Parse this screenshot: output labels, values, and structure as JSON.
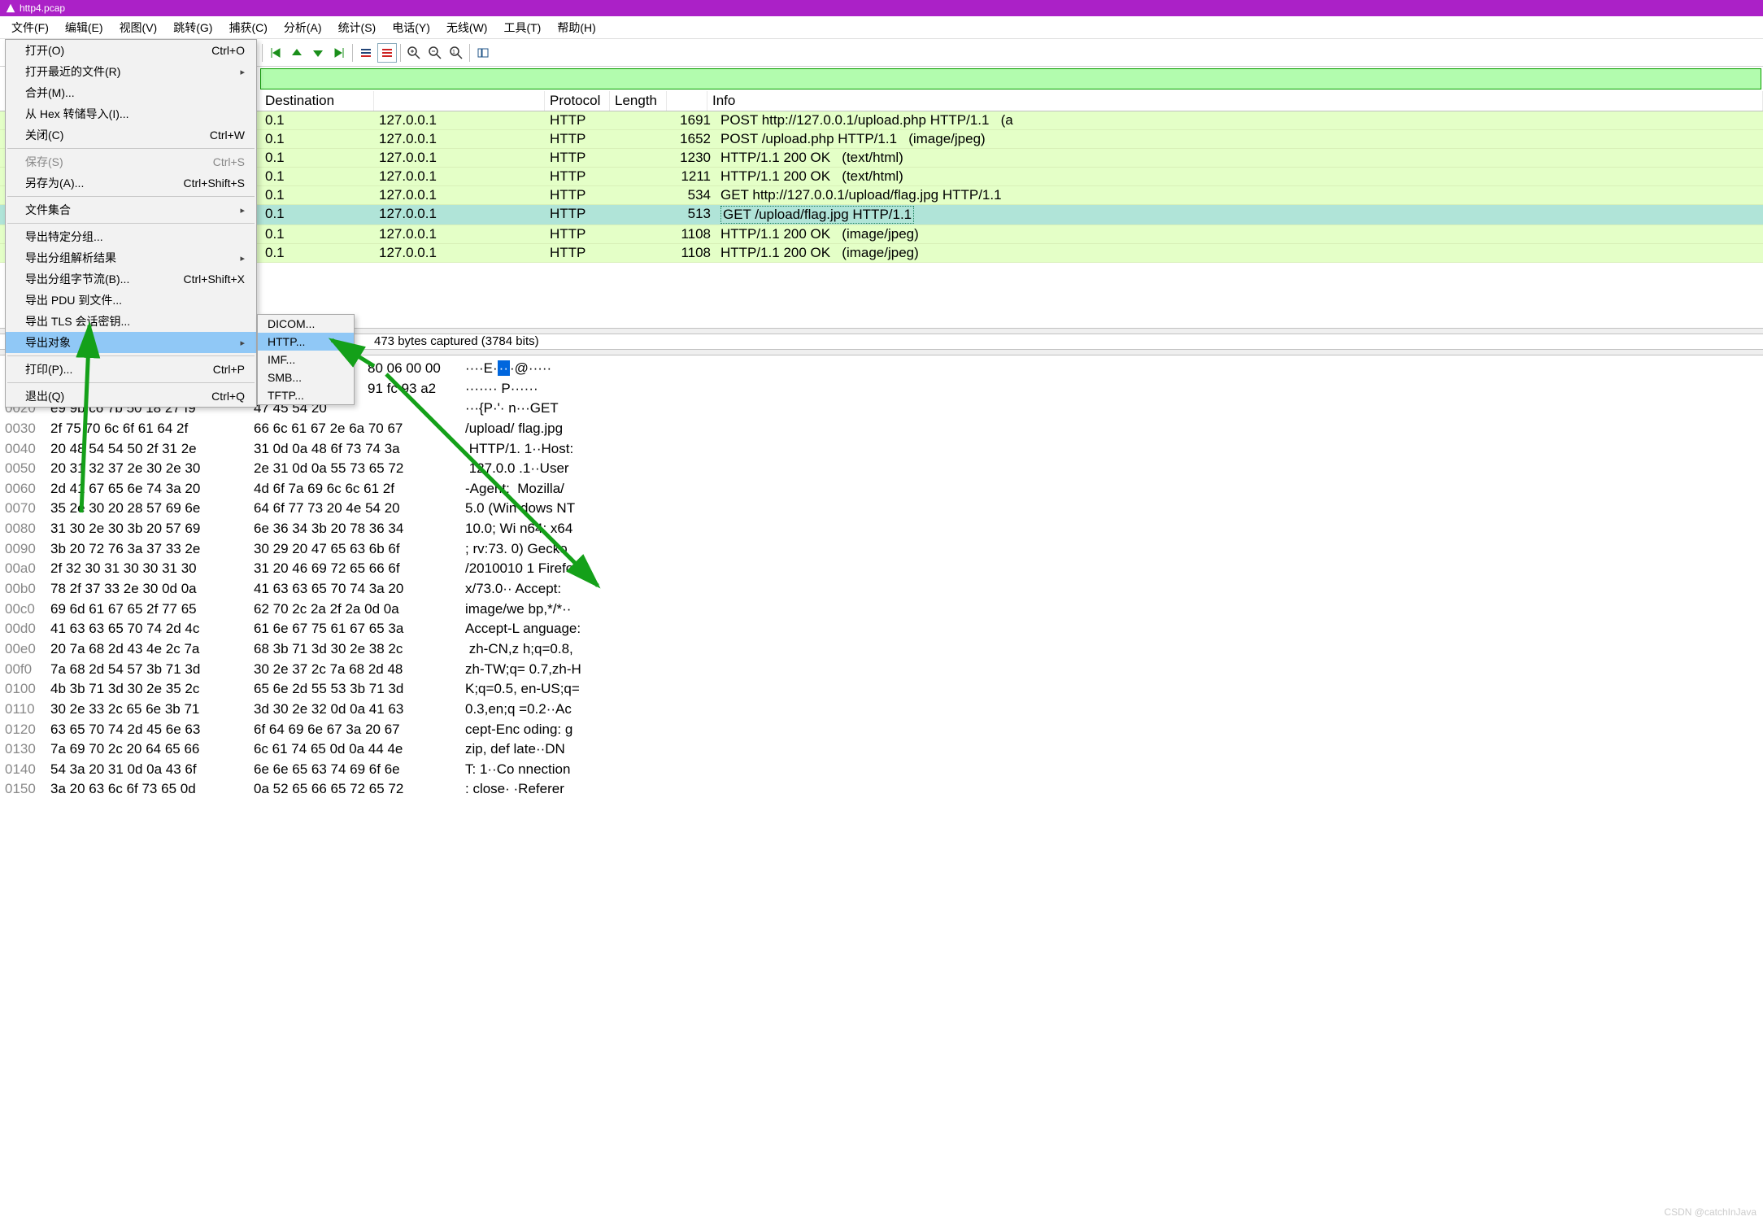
{
  "title": "http4.pcap",
  "menubar": [
    "文件(F)",
    "编辑(E)",
    "视图(V)",
    "跳转(G)",
    "捕获(C)",
    "分析(A)",
    "统计(S)",
    "电话(Y)",
    "无线(W)",
    "工具(T)",
    "帮助(H)"
  ],
  "file_menu": [
    {
      "label": "打开(O)",
      "accel": "Ctrl+O"
    },
    {
      "label": "打开最近的文件(R)",
      "accel": "",
      "arrow": true
    },
    {
      "label": "合并(M)...",
      "accel": ""
    },
    {
      "label": "从 Hex 转储导入(I)...",
      "accel": ""
    },
    {
      "label": "关闭(C)",
      "accel": "Ctrl+W"
    },
    {
      "sep": true
    },
    {
      "label": "保存(S)",
      "accel": "Ctrl+S",
      "dis": true
    },
    {
      "label": "另存为(A)...",
      "accel": "Ctrl+Shift+S"
    },
    {
      "sep": true
    },
    {
      "label": "文件集合",
      "accel": "",
      "arrow": true
    },
    {
      "sep": true
    },
    {
      "label": "导出特定分组...",
      "accel": ""
    },
    {
      "label": "导出分组解析结果",
      "accel": "",
      "arrow": true
    },
    {
      "label": "导出分组字节流(B)...",
      "accel": "Ctrl+Shift+X"
    },
    {
      "label": "导出 PDU 到文件...",
      "accel": ""
    },
    {
      "label": "导出 TLS 会话密钥...",
      "accel": ""
    },
    {
      "label": "导出对象",
      "accel": "",
      "arrow": true,
      "hl": true
    },
    {
      "sep": true
    },
    {
      "label": "打印(P)...",
      "accel": "Ctrl+P"
    },
    {
      "sep": true
    },
    {
      "label": "退出(Q)",
      "accel": "Ctrl+Q"
    }
  ],
  "submenu": [
    "DICOM...",
    "HTTP...",
    "IMF...",
    "SMB...",
    "TFTP..."
  ],
  "submenu_hl": 1,
  "packet_headers": {
    "dest": "Destination",
    "proto": "Protocol",
    "len": "Length",
    "info": "Info"
  },
  "packets": [
    {
      "sfx": "0.1",
      "dst": "127.0.0.1",
      "proto": "HTTP",
      "len": "1691",
      "info": "POST http://127.0.0.1/upload.php HTTP/1.1   (a"
    },
    {
      "sfx": "0.1",
      "dst": "127.0.0.1",
      "proto": "HTTP",
      "len": "1652",
      "info": "POST /upload.php HTTP/1.1   (image/jpeg)"
    },
    {
      "sfx": "0.1",
      "dst": "127.0.0.1",
      "proto": "HTTP",
      "len": "1230",
      "info": "HTTP/1.1 200 OK   (text/html)"
    },
    {
      "sfx": "0.1",
      "dst": "127.0.0.1",
      "proto": "HTTP",
      "len": "1211",
      "info": "HTTP/1.1 200 OK   (text/html)"
    },
    {
      "sfx": "0.1",
      "dst": "127.0.0.1",
      "proto": "HTTP",
      "len": "534",
      "info": "GET http://127.0.0.1/upload/flag.jpg HTTP/1.1"
    },
    {
      "sfx": "0.1",
      "dst": "127.0.0.1",
      "proto": "HTTP",
      "len": "513",
      "info": "GET /upload/flag.jpg HTTP/1.1",
      "sel": true,
      "infobox": true
    },
    {
      "sfx": "0.1",
      "dst": "127.0.0.1",
      "proto": "HTTP",
      "len": "1108",
      "info": "HTTP/1.1 200 OK   (image/jpeg)"
    },
    {
      "sfx": "0.1",
      "dst": "127.0.0.1",
      "proto": "HTTP",
      "len": "1108",
      "info": "HTTP/1.1 200 OK   (image/jpeg)"
    }
  ],
  "details_line": "473 bytes captured (3784 bits)",
  "hexrows": [
    {
      "a": "",
      "b1": "",
      "b2": "80 06 00 00",
      "asc": "····E·",
      "asc2": "·@·····",
      "mark": "··"
    },
    {
      "a": "",
      "b1": "",
      "b2": "91 fc 93 a2",
      "asc": "·······",
      "asc2": "P······"
    },
    {
      "a": "0020",
      "b1": "e9 9b c6 7b 50 18 27 f9",
      "b2": "47 45 54 20",
      "asc": "···{P·'·",
      "asc2": "n···GET "
    },
    {
      "a": "0030",
      "b1": "2f 75 70 6c 6f 61 64 2f",
      "b2": "66 6c 61 67 2e 6a 70 67",
      "asc": "/upload/",
      "asc2": "flag.jpg"
    },
    {
      "a": "0040",
      "b1": "20 48 54 54 50 2f 31 2e",
      "b2": "31 0d 0a 48 6f 73 74 3a",
      "asc": " HTTP/1.",
      "asc2": "1··Host:"
    },
    {
      "a": "0050",
      "b1": "20 31 32 37 2e 30 2e 30",
      "b2": "2e 31 0d 0a 55 73 65 72",
      "asc": " 127.0.0",
      "asc2": ".1··User"
    },
    {
      "a": "0060",
      "b1": "2d 41 67 65 6e 74 3a 20",
      "b2": "4d 6f 7a 69 6c 6c 61 2f",
      "asc": "-Agent: ",
      "asc2": "Mozilla/"
    },
    {
      "a": "0070",
      "b1": "35 2e 30 20 28 57 69 6e",
      "b2": "64 6f 77 73 20 4e 54 20",
      "asc": "5.0 (Win",
      "asc2": "dows NT "
    },
    {
      "a": "0080",
      "b1": "31 30 2e 30 3b 20 57 69",
      "b2": "6e 36 34 3b 20 78 36 34",
      "asc": "10.0; Wi",
      "asc2": "n64; x64"
    },
    {
      "a": "0090",
      "b1": "3b 20 72 76 3a 37 33 2e",
      "b2": "30 29 20 47 65 63 6b 6f",
      "asc": "; rv:73.",
      "asc2": "0) Gecko"
    },
    {
      "a": "00a0",
      "b1": "2f 32 30 31 30 30 31 30",
      "b2": "31 20 46 69 72 65 66 6f",
      "asc": "/2010010",
      "asc2": "1 Firefo"
    },
    {
      "a": "00b0",
      "b1": "78 2f 37 33 2e 30 0d 0a",
      "b2": "41 63 63 65 70 74 3a 20",
      "asc": "x/73.0··",
      "asc2": "Accept: "
    },
    {
      "a": "00c0",
      "b1": "69 6d 61 67 65 2f 77 65",
      "b2": "62 70 2c 2a 2f 2a 0d 0a",
      "asc": "image/we",
      "asc2": "bp,*/*··"
    },
    {
      "a": "00d0",
      "b1": "41 63 63 65 70 74 2d 4c",
      "b2": "61 6e 67 75 61 67 65 3a",
      "asc": "Accept-L",
      "asc2": "anguage:"
    },
    {
      "a": "00e0",
      "b1": "20 7a 68 2d 43 4e 2c 7a",
      "b2": "68 3b 71 3d 30 2e 38 2c",
      "asc": " zh-CN,z",
      "asc2": "h;q=0.8,"
    },
    {
      "a": "00f0",
      "b1": "7a 68 2d 54 57 3b 71 3d",
      "b2": "30 2e 37 2c 7a 68 2d 48",
      "asc": "zh-TW;q=",
      "asc2": "0.7,zh-H"
    },
    {
      "a": "0100",
      "b1": "4b 3b 71 3d 30 2e 35 2c",
      "b2": "65 6e 2d 55 53 3b 71 3d",
      "asc": "K;q=0.5,",
      "asc2": "en-US;q="
    },
    {
      "a": "0110",
      "b1": "30 2e 33 2c 65 6e 3b 71",
      "b2": "3d 30 2e 32 0d 0a 41 63",
      "asc": "0.3,en;q",
      "asc2": "=0.2··Ac"
    },
    {
      "a": "0120",
      "b1": "63 65 70 74 2d 45 6e 63",
      "b2": "6f 64 69 6e 67 3a 20 67",
      "asc": "cept-Enc",
      "asc2": "oding: g"
    },
    {
      "a": "0130",
      "b1": "7a 69 70 2c 20 64 65 66",
      "b2": "6c 61 74 65 0d 0a 44 4e",
      "asc": "zip, def",
      "asc2": "late··DN"
    },
    {
      "a": "0140",
      "b1": "54 3a 20 31 0d 0a 43 6f",
      "b2": "6e 6e 65 63 74 69 6f 6e",
      "asc": "T: 1··Co",
      "asc2": "nnection"
    },
    {
      "a": "0150",
      "b1": "3a 20 63 6c 6f 73 65 0d",
      "b2": "0a 52 65 66 65 72 65 72",
      "asc": ": close·",
      "asc2": "·Referer"
    }
  ],
  "watermark": "CSDN @catchInJava"
}
